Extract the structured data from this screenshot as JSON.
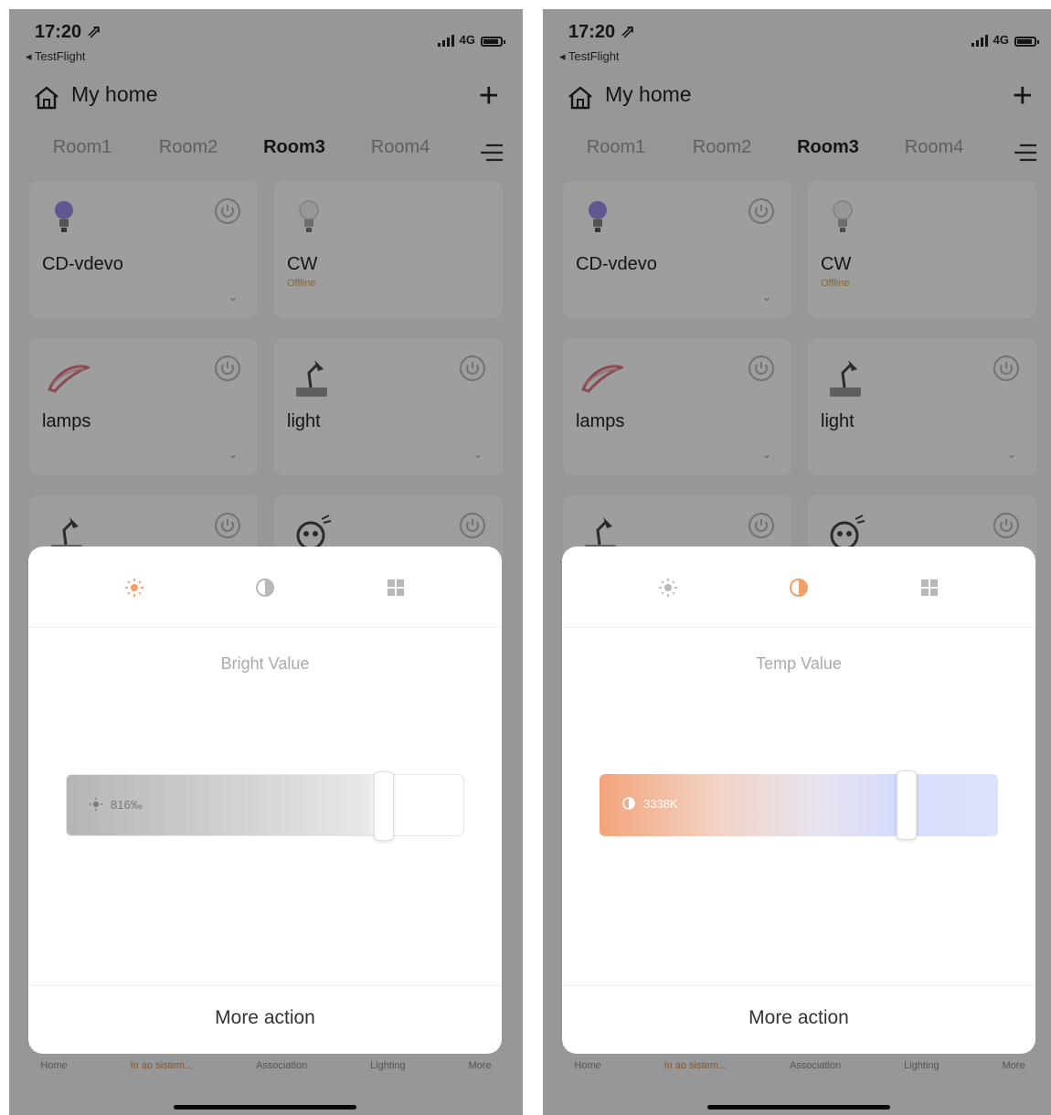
{
  "colors": {
    "accent": "#f0a06a",
    "inactive_icon": "#b8b8b8",
    "text": "#222222"
  },
  "status_bar": {
    "time": "17:20 ⇗",
    "back": "◂ TestFlight",
    "network": "4G"
  },
  "header": {
    "title": "My home",
    "add_symbol": "+"
  },
  "rooms": [
    "Room1",
    "Room2",
    "Room3",
    "Room4"
  ],
  "active_room": "Room3",
  "devices": [
    {
      "name": "CD-vdevo",
      "sub": "",
      "icon": "bulb-color-icon"
    },
    {
      "name": "CW",
      "sub": "Offline",
      "icon": "bulb-white-icon"
    },
    {
      "name": "lamps",
      "sub": "",
      "icon": "light-strip-icon"
    },
    {
      "name": "light",
      "sub": "",
      "icon": "desk-lamp-icon"
    },
    {
      "name": "",
      "sub": "",
      "icon": "desk-lamp-icon"
    },
    {
      "name": "",
      "sub": "",
      "icon": "robot-light-icon"
    }
  ],
  "tabbar": [
    "Home",
    "In ao sistem...",
    "Association",
    "Lighting",
    "More"
  ],
  "screens": {
    "left": {
      "active_mode": "brightness",
      "label": "Bright Value",
      "value_text": "​816‰",
      "level": 0.8
    },
    "right": {
      "active_mode": "temperature",
      "label": "Temp Value",
      "value_text": "​3338K",
      "level": 0.77
    }
  },
  "more_action": "More action"
}
